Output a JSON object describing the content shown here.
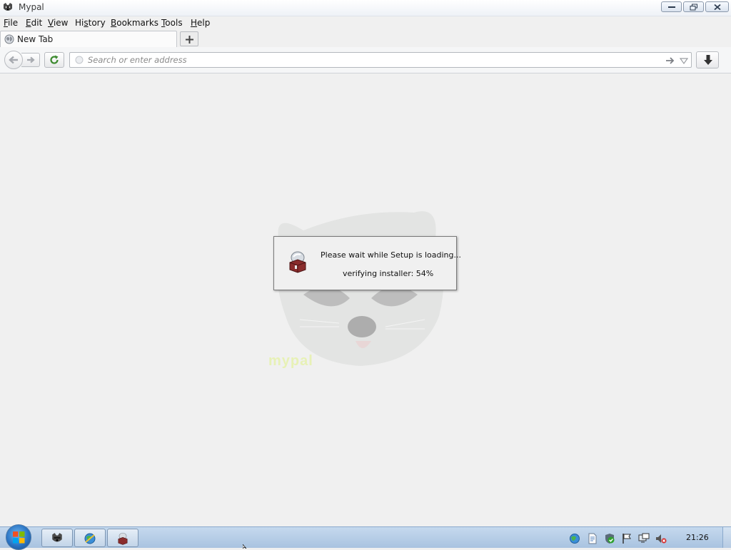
{
  "window": {
    "title": "Mypal",
    "buttons": [
      "minimize",
      "maximize",
      "close"
    ]
  },
  "menubar": {
    "items": [
      {
        "accel": "F",
        "rest": "ile"
      },
      {
        "accel": "E",
        "rest": "dit"
      },
      {
        "accel": "V",
        "rest": "iew"
      },
      {
        "pre": "Hi",
        "accel": "s",
        "rest": "tory"
      },
      {
        "accel": "B",
        "rest": "ookmarks"
      },
      {
        "accel": "T",
        "rest": "ools"
      },
      {
        "accel": "H",
        "rest": "elp"
      }
    ]
  },
  "tabs": [
    {
      "label": "New Tab",
      "icon": "globe-icon"
    }
  ],
  "navbar": {
    "url_placeholder": "Search or enter address",
    "url_value": ""
  },
  "dialog": {
    "message": "Please wait while Setup is loading...",
    "status": "verifying installer: 54%",
    "progress_percent": 54,
    "icon": "installer-box-icon"
  },
  "content": {
    "splash_wordmark": "mypal",
    "splash_image": "raccoon-face"
  },
  "taskbar": {
    "start": "windows-start-orb",
    "items": [
      {
        "icon": "mypal-raccoon-icon"
      },
      {
        "icon": "network-globe-icon"
      },
      {
        "icon": "installer-box-icon"
      }
    ],
    "tray": [
      "network-globe-icon",
      "document-icon",
      "security-shield-icon",
      "action-center-flag-icon",
      "network-monitor-icon",
      "volume-muted-icon"
    ],
    "clock": "21:26"
  },
  "colors": {
    "content_bg": "#f0f0f0",
    "taskbar": "#b6cde6",
    "wordmark": "#e7f1b6"
  }
}
